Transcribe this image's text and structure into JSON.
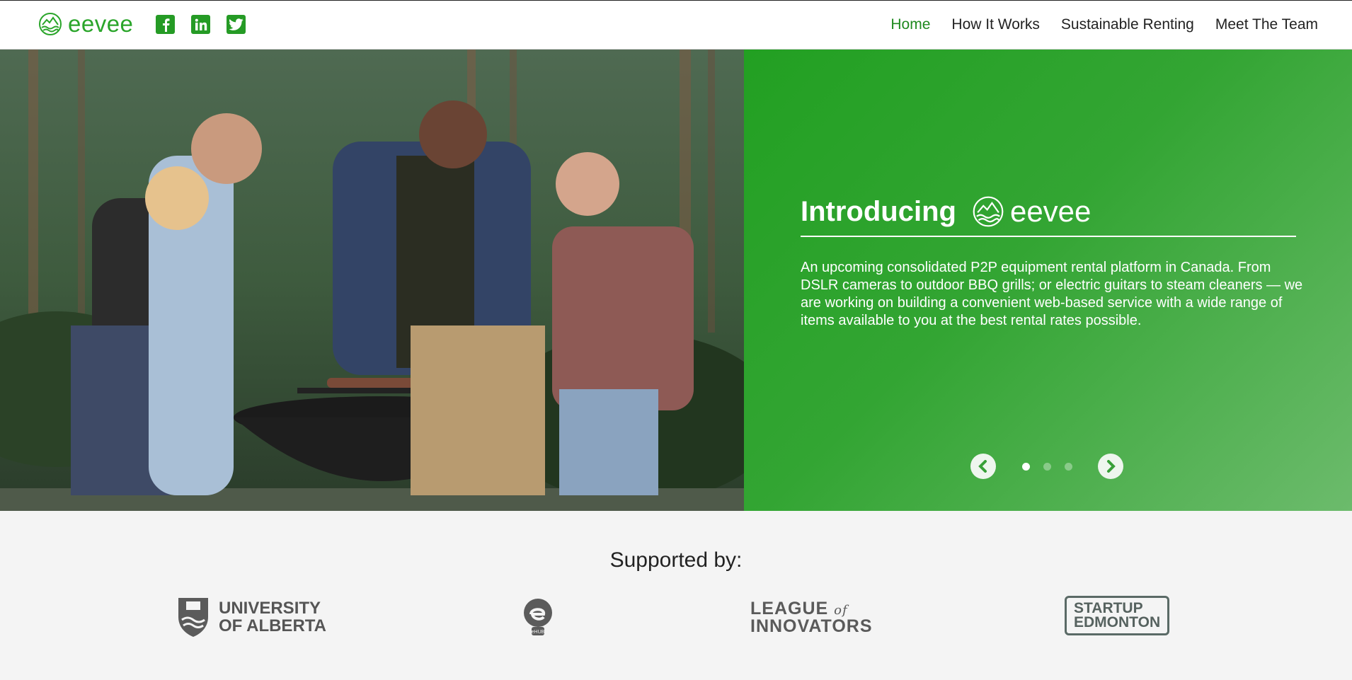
{
  "header": {
    "brand": "eevee",
    "socials": [
      {
        "name": "facebook-icon"
      },
      {
        "name": "linkedin-icon"
      },
      {
        "name": "twitter-icon"
      }
    ],
    "nav": [
      {
        "label": "Home",
        "active": true
      },
      {
        "label": "How It Works",
        "active": false
      },
      {
        "label": "Sustainable Renting",
        "active": false
      },
      {
        "label": "Meet The Team",
        "active": false
      }
    ]
  },
  "hero": {
    "title": "Introducing",
    "brand": "eevee",
    "description": "An upcoming consolidated P2P equipment rental platform in Canada. From DSLR cameras to outdoor BBQ grills; or electric guitars to steam cleaners — we are working on building a convenient web-based service with a wide range of items available to you at the best rental rates possible.",
    "carousel": {
      "slides": 3,
      "active": 1
    }
  },
  "supporters": {
    "heading": "Supported by:",
    "ua_line1": "UNIVERSITY",
    "ua_line2": "OF ALBERTA",
    "ehub": "eHUB",
    "league_line1_a": "LEAGUE",
    "league_line1_b": "of",
    "league_line2": "INNOVATORS",
    "startup_line1": "STARTUP",
    "startup_line2": "EDMONTON"
  },
  "colors": {
    "accent": "#2aa52a",
    "nav_active": "#1f8a1f",
    "panel": "#33a533"
  }
}
